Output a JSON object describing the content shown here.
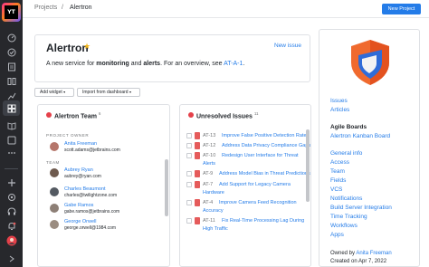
{
  "sidebar": {
    "logo_text": "YT",
    "icons": [
      "dashboard-icon",
      "check-circle-icon",
      "issues-icon",
      "agile-icon",
      "reports-icon",
      "gantt-icon",
      "dashboards-icon",
      "knowledge-base-icon",
      "project-settings-icon",
      "more-icon",
      "add-icon",
      "administration-icon",
      "helpdesk-icon",
      "notifications-icon",
      "help-icon",
      "user-avatar-icon"
    ]
  },
  "breadcrumb": {
    "root": "Projects",
    "separator": "/",
    "current": "Alertron"
  },
  "header": {
    "new_project_label": "New Project"
  },
  "project": {
    "title": "Alertron",
    "new_issue_label": "New issue",
    "desc_prefix": "A new service for ",
    "desc_bold1": "monitoring",
    "desc_mid": " and ",
    "desc_bold2": "alerts",
    "desc_suffix": ". For an overview, see ",
    "desc_link": "AT-A-1",
    "desc_end": "."
  },
  "toolbar": {
    "add_widget_label": "Add widget",
    "import_label": "Import from dashboard"
  },
  "team_widget": {
    "title": "Alertron Team",
    "count": "6",
    "owner_label": "PROJECT OWNER",
    "team_label": "TEAM",
    "owner": {
      "name": "Anita Freeman",
      "email": "scott.adams@jetbrains.com"
    },
    "members": [
      {
        "name": "Aubrey Ryan",
        "email": "aubrey@ryan.com"
      },
      {
        "name": "Charles Beaumont",
        "email": "charles@twilightzone.com"
      },
      {
        "name": "Gabe Ramos",
        "email": "gabe.ramos@jetbrains.com"
      },
      {
        "name": "George Orwell",
        "email": "george.orwell@1984.com"
      }
    ]
  },
  "issues_widget": {
    "title": "Unresolved Issues",
    "count": "11",
    "issues": [
      {
        "id": "AT-13",
        "summary": "Improve False Positive Detection Rate",
        "cont": ""
      },
      {
        "id": "AT-12",
        "summary": "Address Data Privacy Compliance Gaps",
        "cont": ""
      },
      {
        "id": "AT-10",
        "summary": "Redesign User Interface for Threat",
        "cont": "Alerts"
      },
      {
        "id": "AT-9",
        "summary": "Address Model Bias in Threat Predictions",
        "cont": ""
      },
      {
        "id": "AT-7",
        "summary": "Add Support for Legacy Camera",
        "cont": "Hardware"
      },
      {
        "id": "AT-4",
        "summary": "Improve Camera Feed Recognition",
        "cont": "Accuracy"
      },
      {
        "id": "AT-11",
        "summary": "Fix Real-Time Processing Lag During",
        "cont": "High Traffic"
      }
    ]
  },
  "right_panel": {
    "links_top": [
      "Issues",
      "Articles"
    ],
    "boards_heading": "Agile Boards",
    "board_link": "Alertron Kanban Board",
    "settings_links": [
      "General info",
      "Access",
      "Team",
      "Fields",
      "VCS",
      "Notifications",
      "Build Server Integration",
      "Time Tracking",
      "Workflows",
      "Apps"
    ],
    "owned_by_label": "Owned by",
    "owner_name": "Anita Freeman",
    "created_label": "Created on Apr 7, 2022"
  },
  "colors": {
    "accent": "#247ce8",
    "sidebar_bg": "#27282c",
    "star": "#f2b519",
    "priority": "#e55b5b"
  }
}
